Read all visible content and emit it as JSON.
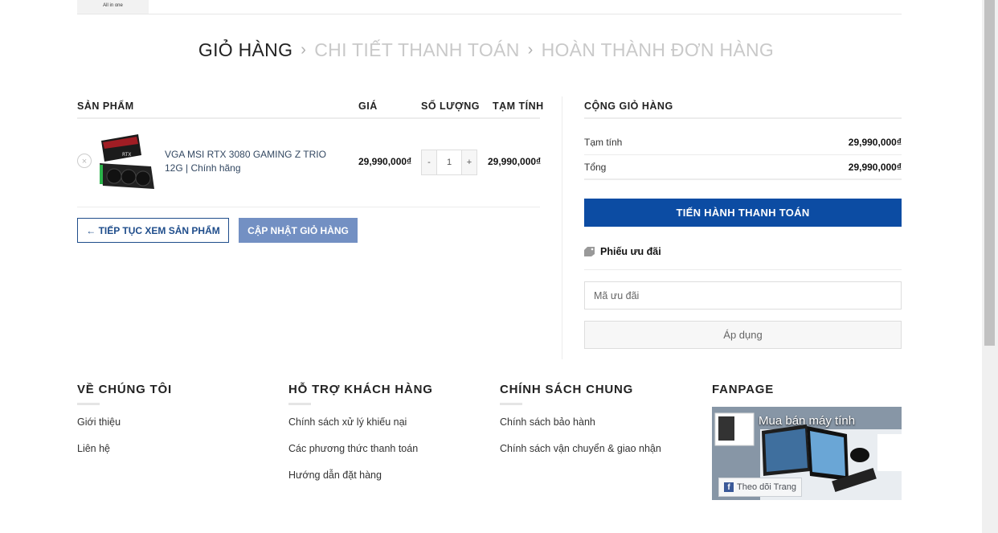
{
  "header": {
    "logo_text": "All in one"
  },
  "steps": [
    {
      "label": "GIỎ HÀNG"
    },
    {
      "label": "CHI TIẾT THANH TOÁN"
    },
    {
      "label": "HOÀN THÀNH ĐƠN HÀNG"
    }
  ],
  "cart": {
    "columns": {
      "product": "SẢN PHẨM",
      "price": "GIÁ",
      "quantity": "SỐ LƯỢNG",
      "subtotal": "TẠM TÍNH"
    },
    "items": [
      {
        "name": "VGA MSI RTX 3080 GAMING Z TRIO 12G | Chính hãng",
        "price": "29,990,000₫",
        "quantity": "1",
        "subtotal": "29,990,000₫"
      }
    ],
    "remove_symbol": "×",
    "minus": "-",
    "plus": "+",
    "continue_label": "← TIẾP TỤC XEM SẢN PHẨM",
    "update_label": "CẬP NHẬT GIỎ HÀNG"
  },
  "totals": {
    "title": "CỘNG GIỎ HÀNG",
    "subtotal_label": "Tạm tính",
    "subtotal_value": "29,990,000₫",
    "total_label": "Tổng",
    "total_value": "29,990,000₫",
    "checkout_label": "TIẾN HÀNH THANH TOÁN",
    "coupon_title": "Phiếu ưu đãi",
    "coupon_placeholder": "Mã ưu đãi",
    "apply_label": "Áp dụng"
  },
  "footer": {
    "about": {
      "title": "VỀ CHÚNG TÔI",
      "links": [
        "Giới thiệu",
        "Liên hệ"
      ]
    },
    "support": {
      "title": "HỖ TRỢ KHÁCH HÀNG",
      "links": [
        "Chính sách xử lý khiếu nại",
        "Các phương thức thanh toán",
        "Hướng dẫn đặt hàng"
      ]
    },
    "policy": {
      "title": "CHÍNH SÁCH CHUNG",
      "links": [
        "Chính sách bảo hành",
        "Chính sách vận chuyển & giao nhận"
      ]
    },
    "fanpage": {
      "title": "FANPAGE",
      "page_name": "Mua bán máy tính",
      "follow_label": "Theo dõi Trang"
    }
  },
  "colors": {
    "primary": "#0c4ca3",
    "outline": "#1f4d8b",
    "update": "#7390c3"
  }
}
